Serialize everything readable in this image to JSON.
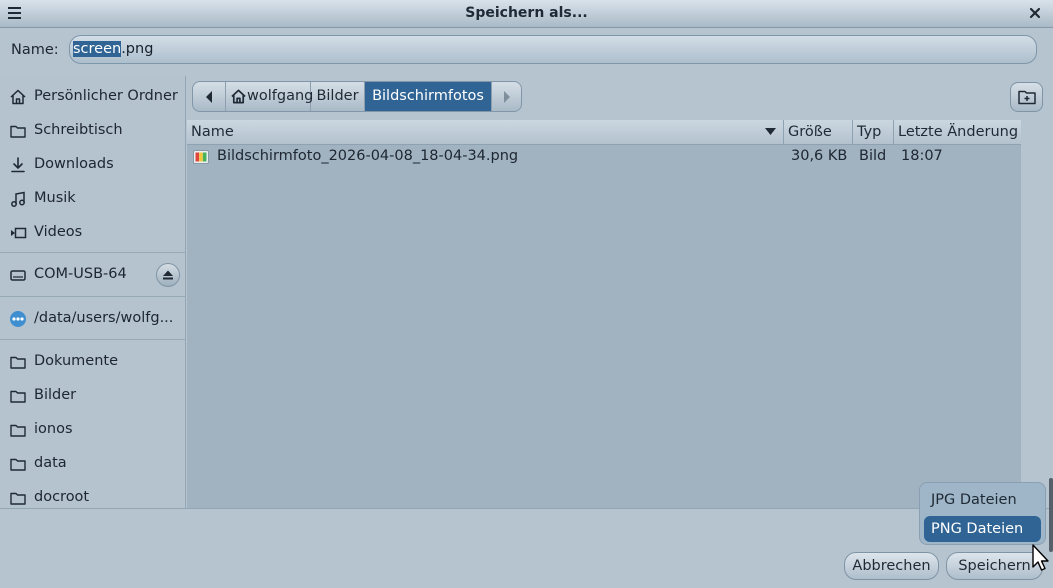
{
  "window": {
    "title": "Speichern als..."
  },
  "name_field": {
    "label": "Name:",
    "selected_part": "screen",
    "rest": ".png"
  },
  "sidebar": {
    "places": [
      {
        "label": "Persönlicher Ordner",
        "icon": "home-icon"
      },
      {
        "label": "Schreibtisch",
        "icon": "folder-icon"
      },
      {
        "label": "Downloads",
        "icon": "download-icon"
      },
      {
        "label": "Musik",
        "icon": "music-icon"
      },
      {
        "label": "Videos",
        "icon": "video-icon"
      }
    ],
    "devices": [
      {
        "label": "COM-USB-64",
        "icon": "drive-icon"
      }
    ],
    "network": [
      {
        "label": "/data/users/wolfg...",
        "icon": "network-icon"
      }
    ],
    "bookmarks": [
      {
        "label": "Dokumente",
        "icon": "folder-icon"
      },
      {
        "label": "Bilder",
        "icon": "folder-icon"
      },
      {
        "label": "ionos",
        "icon": "folder-icon"
      },
      {
        "label": "data",
        "icon": "folder-icon"
      },
      {
        "label": "docroot",
        "icon": "folder-icon"
      }
    ]
  },
  "pathbar": {
    "segments": [
      "wolfgang",
      "Bilder",
      "Bildschirmfotos"
    ],
    "active_index": 2
  },
  "file_list": {
    "columns": [
      "Name",
      "Größe",
      "Typ",
      "Letzte Änderung"
    ],
    "rows": [
      {
        "name": "Bildschirmfoto_2026-04-08_18-04-34.png",
        "size": "30,6 KB",
        "type": "Bild",
        "modified": "18:07"
      }
    ]
  },
  "filter_menu": {
    "options": [
      "JPG Dateien",
      "PNG Dateien"
    ],
    "selected_index": 1
  },
  "buttons": {
    "cancel": "Abbrechen",
    "save": "Speichern"
  },
  "colors": {
    "accent": "#2f6494",
    "background": "#b6c4cf",
    "list_background": "#a1b3c1"
  }
}
